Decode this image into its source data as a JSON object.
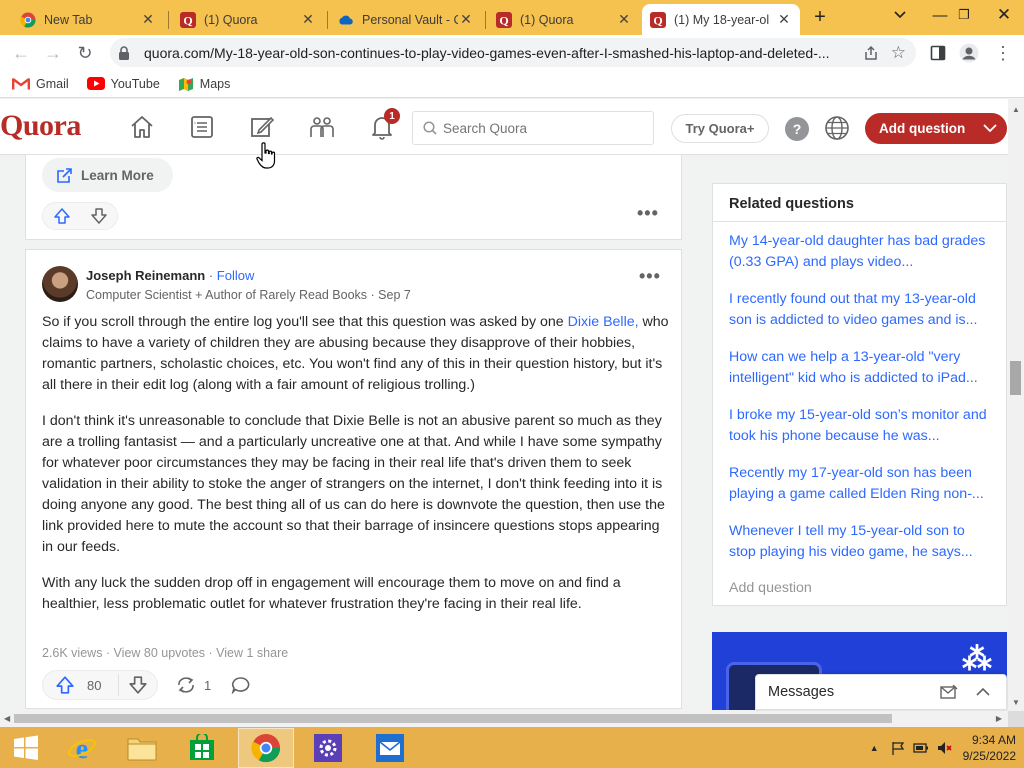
{
  "browser": {
    "tabs": [
      {
        "title": "New Tab",
        "icon": "chrome-icon"
      },
      {
        "title": "(1) Quora",
        "icon": "quora-icon"
      },
      {
        "title": "Personal Vault - C",
        "icon": "onedrive-icon"
      },
      {
        "title": "(1) Quora",
        "icon": "quora-icon"
      },
      {
        "title": "(1) My 18-year-ol",
        "icon": "quora-icon",
        "active": true
      }
    ],
    "url": "quora.com/My-18-year-old-son-continues-to-play-video-games-even-after-I-smashed-his-laptop-and-deleted-...",
    "bookmarks": [
      {
        "label": "Gmail",
        "icon": "gmail-icon"
      },
      {
        "label": "YouTube",
        "icon": "youtube-icon"
      },
      {
        "label": "Maps",
        "icon": "maps-icon"
      }
    ]
  },
  "quora": {
    "logo": "Quora",
    "notification_count": "1",
    "search_placeholder": "Search Quora",
    "try_label": "Try Quora+",
    "help_label": "?",
    "add_question_label": "Add question",
    "brand_color": "#b92b27"
  },
  "prev_card": {
    "learn_more": "Learn More"
  },
  "answer": {
    "author": "Joseph Reinemann",
    "follow": "Follow",
    "separator": "·",
    "credential": "Computer Scientist + Author of Rarely Read Books · Sep 7",
    "p1_before": "So if you scroll through the entire log you'll see that this question was asked by one ",
    "p1_link": "Dixie Belle,",
    "p1_after": " who claims to have a variety of children they are abusing because they disapprove of their hobbies, romantic partners, scholastic choices, etc. You won't find any of this in their question history, but it's all there in their edit log (along with a fair amount of religious trolling.)",
    "p2": "I don't think it's unreasonable to conclude that Dixie Belle is not an abusive parent so much as they are a trolling fantasist — and a particularly uncreative one at that. And while I have some sympathy for whatever poor circumstances they may be facing in their real life that's driven them to seek validation in their ability to stoke the anger of strangers on the internet, I don't think feeding into it is doing anyone any good. The best thing all of us can do here is downvote the question, then use the link provided here to mute the account so that their barrage of insincere questions stops appearing in our feeds.",
    "p3": "With any luck the sudden drop off in engagement will encourage them to move on and find a healthier, less problematic outlet for whatever frustration they're facing in their real life.",
    "stats": "2.6K views · View 80 upvotes · View 1 share",
    "upvotes": "80",
    "shares": "1"
  },
  "sidebar": {
    "title": "Related questions",
    "questions": [
      "My 14-year-old daughter has bad grades (0.33 GPA) and plays video...",
      "I recently found out that my 13-year-old son is addicted to video games and is...",
      "How can we help a 13-year-old \"very intelligent\" kid who is addicted to iPad...",
      "I broke my 15-year-old son’s monitor and took his phone because he was...",
      "Recently my 17-year-old son has been playing a game called Elden Ring non-...",
      "Whenever I tell my 15-year-old son to stop playing his video game, he says..."
    ],
    "add_question": "Add question",
    "messages": "Messages"
  },
  "taskbar": {
    "apps": [
      "start-icon",
      "ie-icon",
      "file-explorer-icon",
      "store-icon",
      "chrome-icon",
      "settings-icon",
      "mail-icon"
    ],
    "time": "9:34 AM",
    "date": "9/25/2022"
  }
}
